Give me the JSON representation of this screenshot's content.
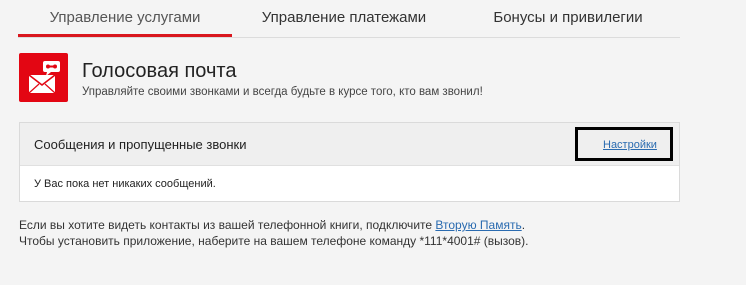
{
  "tabs": [
    {
      "label": "Управление услугами",
      "active": true
    },
    {
      "label": "Управление платежами",
      "active": false
    },
    {
      "label": "Бонусы и привилегии",
      "active": false
    }
  ],
  "header": {
    "icon": "voicemail-envelope-icon",
    "title": "Голосовая почта",
    "subtitle": "Управляйте своими звонками и всегда будьте в курсе того, кто вам звонил!"
  },
  "panel": {
    "title": "Сообщения и пропущенные звонки",
    "settings_link": "Настройки",
    "empty_message": "У Вас пока нет никаких сообщений."
  },
  "info": {
    "line1_prefix": "Если вы хотите видеть контакты из вашей телефонной книги, подключите ",
    "line1_link": "Вторую Память",
    "line1_suffix": ".",
    "line2": "Чтобы установить приложение, наберите на вашем телефоне команду *111*4001# (вызов)."
  },
  "colors": {
    "accent": "#e30613",
    "link": "#2a6bb0",
    "background": "#f4f4f4"
  }
}
